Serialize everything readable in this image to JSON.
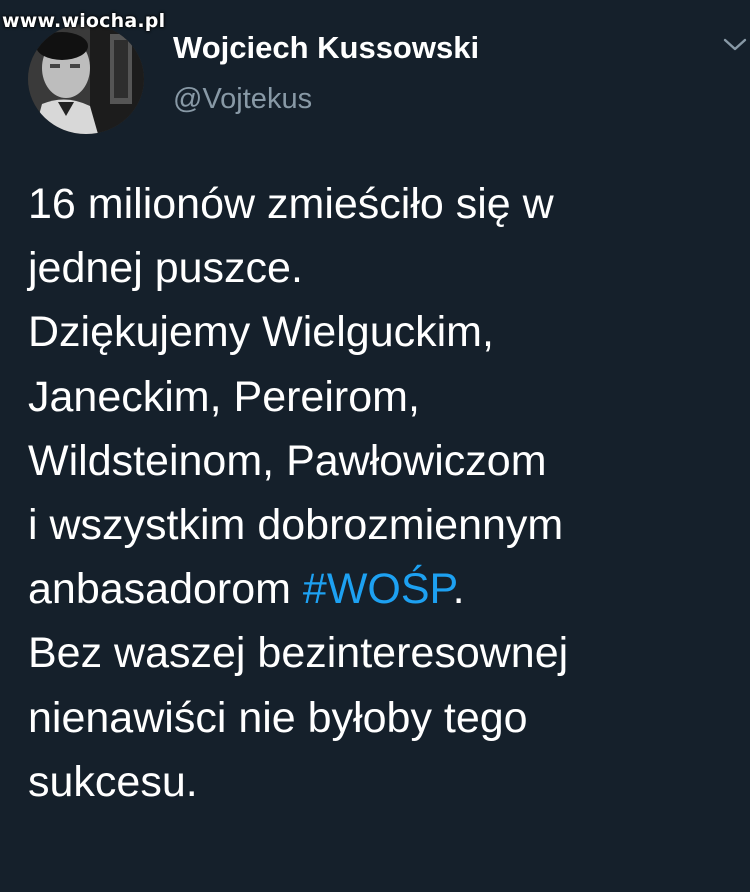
{
  "watermark": "www.wiocha.pl",
  "tweet": {
    "author_name": "Wojciech Kussowski",
    "author_handle": "@Vojtekus",
    "lines": [
      "16 milionów zmieściło się w",
      "jednej puszce.",
      "Dziękujemy Wielguckim,",
      "Janeckim, Pereirom,",
      "Wildsteinom, Pawłowiczom",
      "i wszystkim dobrozmiennym"
    ],
    "line7_text": "anbasadorom ",
    "hashtag": "#WOŚP",
    "line7_suffix": ".",
    "lines_after": [
      "Bez waszej bezinteresownej",
      "nienawiści nie byłoby tego",
      "sukcesu."
    ]
  },
  "colors": {
    "background": "#15202b",
    "text": "#ffffff",
    "secondary": "#8899a6",
    "hashtag": "#1da1f2"
  },
  "icons": {
    "menu": "chevron-down-icon"
  }
}
